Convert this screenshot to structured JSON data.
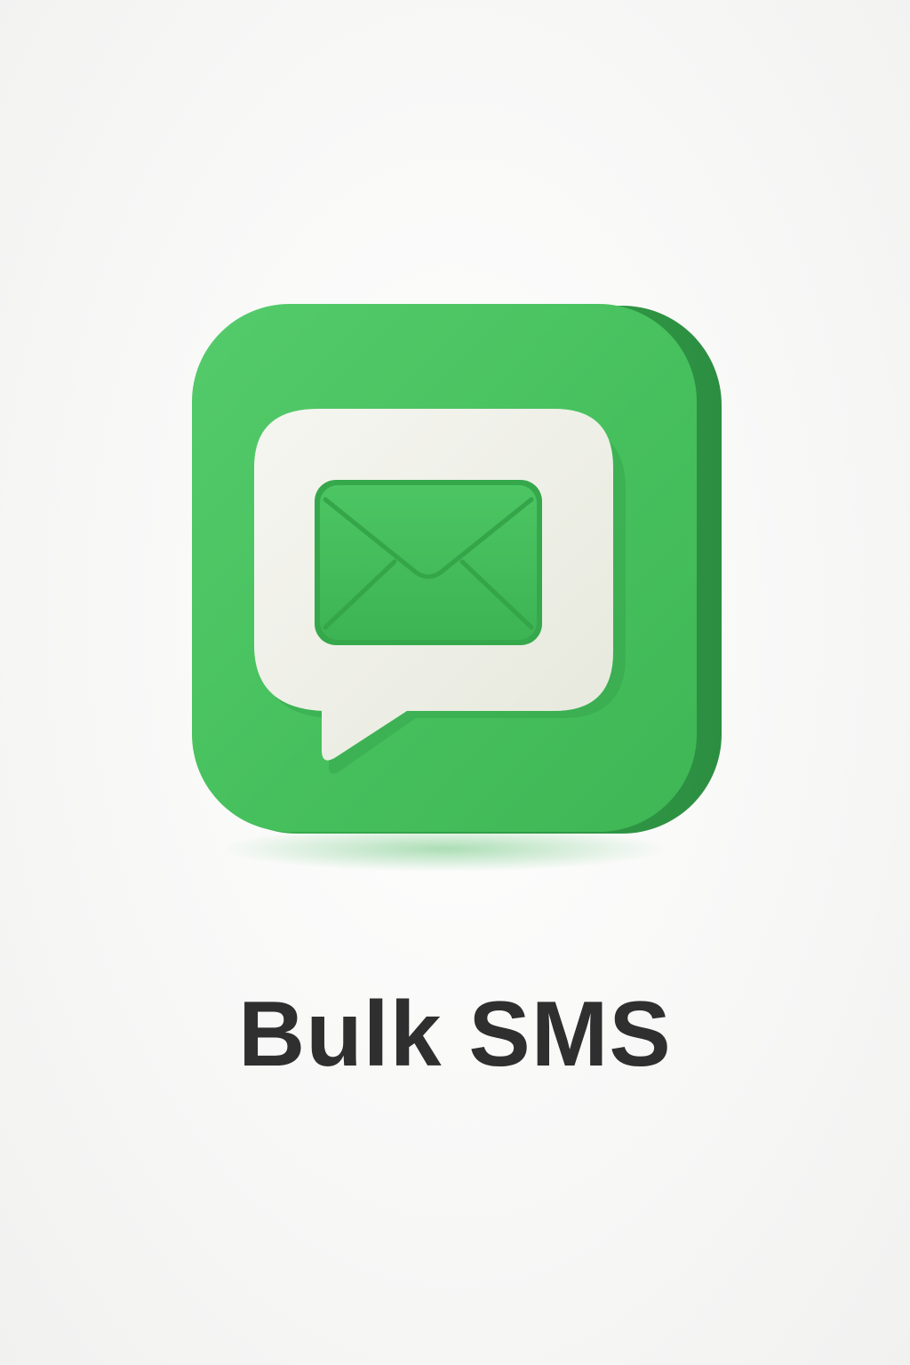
{
  "app": {
    "label": "Bulk SMS",
    "icon": "chat-bubble-envelope-icon"
  },
  "colors": {
    "background": "#f7f7f6",
    "icon_green": "#47c15f",
    "icon_green_dark": "#2f9a45",
    "bubble_white": "#eff0e8",
    "envelope_green": "#43c05a",
    "label_text": "#2f2f2f"
  }
}
